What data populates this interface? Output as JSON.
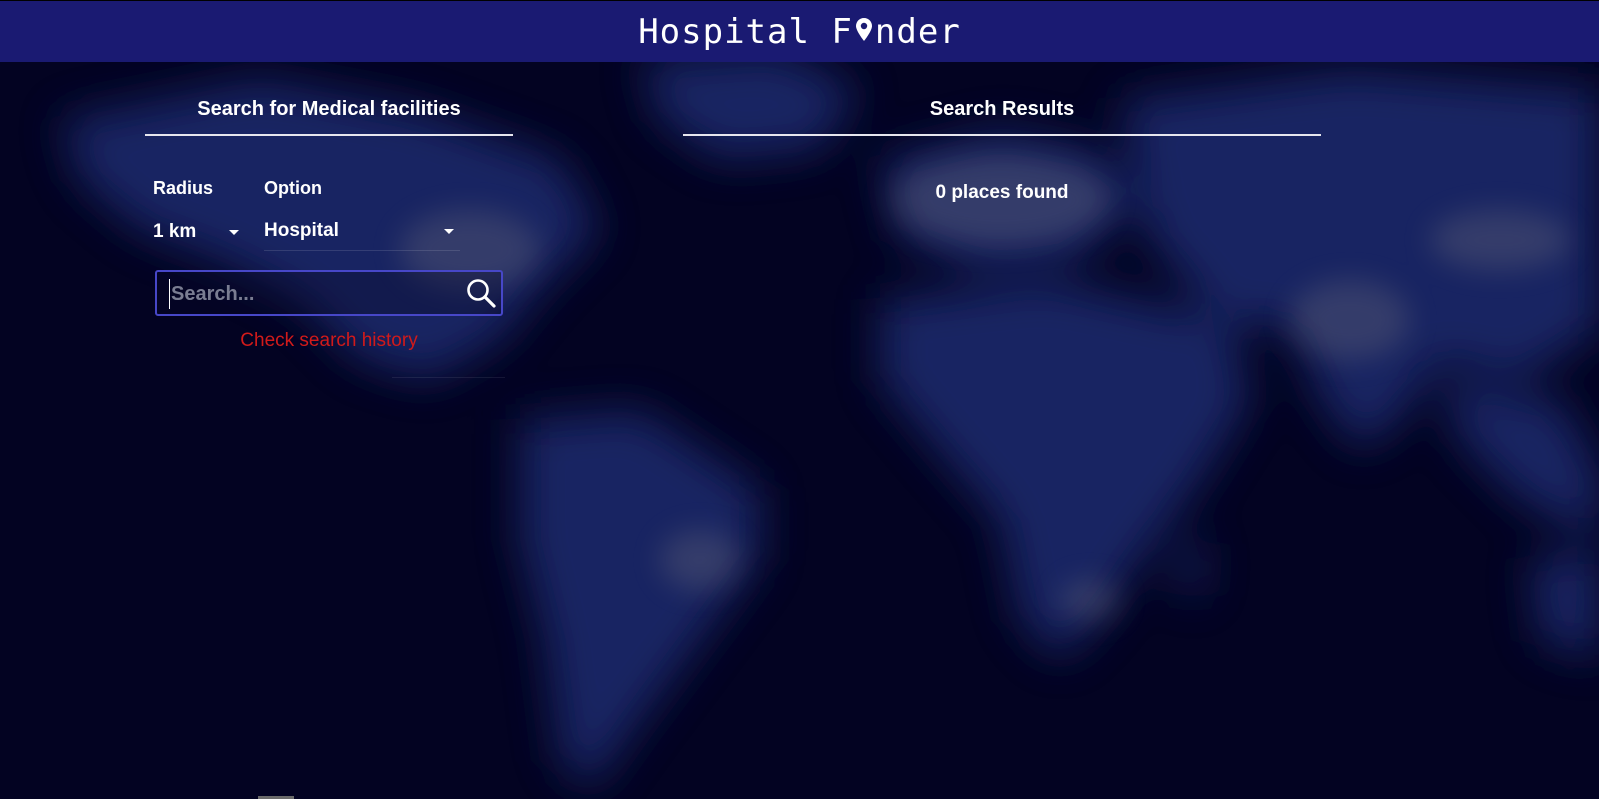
{
  "header": {
    "title_before": "Hospital F",
    "title_after": "nder",
    "icon": "map-pin-icon",
    "background_color": "#1a1a72"
  },
  "search_panel": {
    "heading": "Search for Medical facilities",
    "radius_label": "Radius",
    "radius_value": "1 km",
    "option_label": "Option",
    "option_value": "Hospital",
    "search_placeholder": "Search...",
    "search_value": "",
    "search_icon": "search-icon",
    "history_link": "Check search history",
    "history_link_color": "#d11a1a",
    "accent_border_color": "#4747c8"
  },
  "results_panel": {
    "heading": "Search Results",
    "count_text": "0 places found"
  },
  "colors": {
    "page_background": "#030322",
    "map_tint": "#1c2a6e"
  }
}
